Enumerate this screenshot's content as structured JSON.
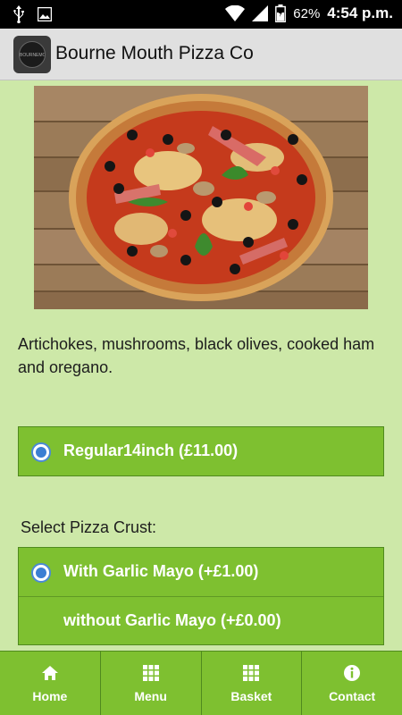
{
  "status_bar": {
    "battery_percent": "62%",
    "time": "4:54 p.m."
  },
  "app_bar": {
    "title": "Bourne Mouth Pizza Co",
    "logo_text": "BOURNEMOUTH PIZZA CO"
  },
  "product": {
    "description": "Artichokes, mushrooms, black olives, cooked ham and oregano."
  },
  "size_options": [
    {
      "label": "Regular14inch (£11.00)",
      "selected": true
    }
  ],
  "crust": {
    "label": "Select Pizza Crust:",
    "options": [
      {
        "label": "With Garlic Mayo (+£1.00)",
        "selected": true
      },
      {
        "label": "without Garlic Mayo (+£0.00)",
        "selected": false
      }
    ]
  },
  "bottom_nav": [
    {
      "label": "Home",
      "icon": "home-icon"
    },
    {
      "label": "Menu",
      "icon": "grid-icon"
    },
    {
      "label": "Basket",
      "icon": "grid-icon"
    },
    {
      "label": "Contact",
      "icon": "info-icon"
    }
  ],
  "colors": {
    "background": "#cde8a8",
    "accent_green": "#7ec030",
    "radio_blue": "#3b7fd3"
  }
}
